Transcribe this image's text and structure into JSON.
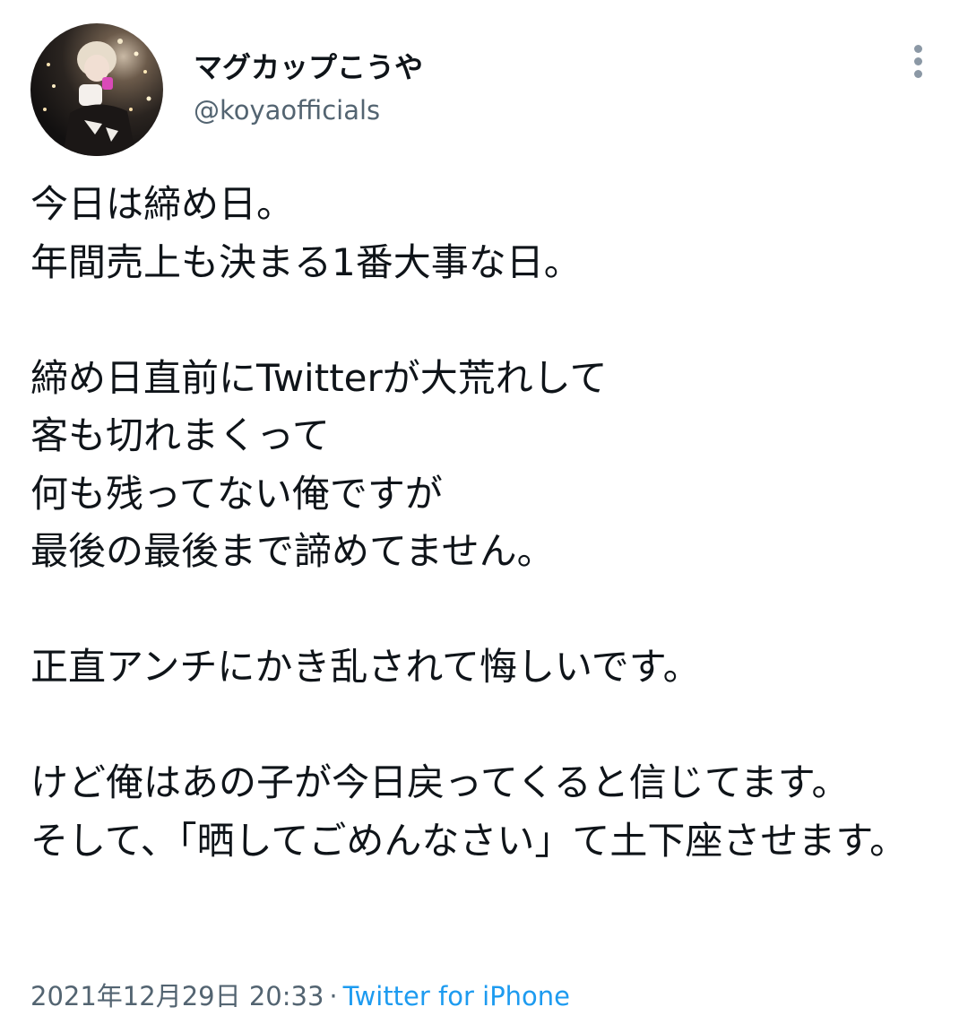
{
  "tweet": {
    "display_name": "マグカップこうや",
    "handle": "@koyaofficials",
    "more_icon": "more-vertical-icon",
    "text": "今日は締め日。\n年間売上も決まる1番大事な日。\n\n締め日直前にTwitterが大荒れして\n客も切れまくって\n何も残ってない俺ですが\n最後の最後まで諦めてません。\n\n正直アンチにかき乱されて悔しいです。\n\nけど俺はあの子が今日戻ってくると信じてます。\nそして、「晒してごめんなさい」て土下座させます。",
    "timestamp": "2021年12月29日 20:33",
    "separator": "·",
    "source": "Twitter for iPhone"
  },
  "colors": {
    "text": "#0f1419",
    "secondary": "#536471",
    "link": "#1d9bf0",
    "icon": "#8b98a5"
  }
}
